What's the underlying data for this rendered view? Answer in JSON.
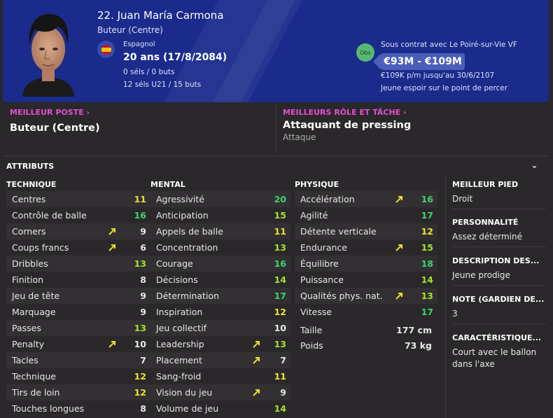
{
  "player": {
    "name": "22. Juan María Carmona",
    "position": "Buteur (Centre)",
    "nationality": "Espagnol",
    "age": "20 ans (17/8/2084)",
    "caps": "0 séls / 0 buts",
    "u21": "12 séls U21 / 15 buts",
    "obs_badge": "Obs",
    "contract": "Sous contrat avec Le Poiré-sur-Vie VF",
    "value": "€93M - €109M",
    "wage": "€109K p/m jusqu'au 30/6/2107",
    "prospect": "Jeune espoir sur le point de percer"
  },
  "best": {
    "position_label": "MEILLEUR POSTE",
    "position_value": "Buteur (Centre)",
    "role_label": "MEILLEURS RÔLE ET TÂCHE",
    "role_value": "Attaquant de pressing",
    "duty_value": "Attaque"
  },
  "attributes_title": "ATTRIBUTS",
  "technical": {
    "title": "TECHNIQUE",
    "items": [
      {
        "name": "Centres",
        "value": "11",
        "arrow": false
      },
      {
        "name": "Contrôle de balle",
        "value": "16",
        "arrow": false
      },
      {
        "name": "Corners",
        "value": "9",
        "arrow": true
      },
      {
        "name": "Coups francs",
        "value": "6",
        "arrow": true
      },
      {
        "name": "Dribbles",
        "value": "13",
        "arrow": false
      },
      {
        "name": "Finition",
        "value": "8",
        "arrow": false
      },
      {
        "name": "Jeu de tête",
        "value": "9",
        "arrow": false
      },
      {
        "name": "Marquage",
        "value": "9",
        "arrow": false
      },
      {
        "name": "Passes",
        "value": "13",
        "arrow": false
      },
      {
        "name": "Penalty",
        "value": "10",
        "arrow": true
      },
      {
        "name": "Tacles",
        "value": "7",
        "arrow": false
      },
      {
        "name": "Technique",
        "value": "12",
        "arrow": false
      },
      {
        "name": "Tirs de loin",
        "value": "12",
        "arrow": false
      },
      {
        "name": "Touches longues",
        "value": "8",
        "arrow": false
      }
    ]
  },
  "mental": {
    "title": "MENTAL",
    "items": [
      {
        "name": "Agressivité",
        "value": "20",
        "arrow": false
      },
      {
        "name": "Anticipation",
        "value": "15",
        "arrow": false
      },
      {
        "name": "Appels de balle",
        "value": "11",
        "arrow": false
      },
      {
        "name": "Concentration",
        "value": "13",
        "arrow": false
      },
      {
        "name": "Courage",
        "value": "16",
        "arrow": false
      },
      {
        "name": "Décisions",
        "value": "14",
        "arrow": false
      },
      {
        "name": "Détermination",
        "value": "17",
        "arrow": false
      },
      {
        "name": "Inspiration",
        "value": "12",
        "arrow": false
      },
      {
        "name": "Jeu collectif",
        "value": "10",
        "arrow": false
      },
      {
        "name": "Leadership",
        "value": "13",
        "arrow": true
      },
      {
        "name": "Placement",
        "value": "7",
        "arrow": true
      },
      {
        "name": "Sang-froid",
        "value": "11",
        "arrow": false
      },
      {
        "name": "Vision du jeu",
        "value": "9",
        "arrow": true
      },
      {
        "name": "Volume de jeu",
        "value": "14",
        "arrow": false
      }
    ]
  },
  "physical": {
    "title": "PHYSIQUE",
    "items": [
      {
        "name": "Accélération",
        "value": "16",
        "arrow": true
      },
      {
        "name": "Agilité",
        "value": "17",
        "arrow": false
      },
      {
        "name": "Détente verticale",
        "value": "12",
        "arrow": false
      },
      {
        "name": "Endurance",
        "value": "15",
        "arrow": true
      },
      {
        "name": "Équilibre",
        "value": "18",
        "arrow": false
      },
      {
        "name": "Puissance",
        "value": "14",
        "arrow": false
      },
      {
        "name": "Qualités phys. nat.",
        "value": "13",
        "arrow": true
      },
      {
        "name": "Vitesse",
        "value": "17",
        "arrow": false
      }
    ],
    "height_label": "Taille",
    "height_value": "177 cm",
    "weight_label": "Poids",
    "weight_value": "73 kg"
  },
  "side": {
    "foot_label": "MEILLEUR PIED",
    "foot_value": "Droit",
    "personality_label": "PERSONNALITÉ",
    "personality_value": "Assez déterminé",
    "description_label": "DESCRIPTION DES...",
    "description_value": "Jeune prodige",
    "gk_label": "NOTE (GARDIEN DE...",
    "gk_value": "3",
    "trait_label": "CARACTÉRISTIQUE...",
    "trait_value": "Court avec le ballon dans l'axe"
  },
  "colors": {
    "header_bg": "#1a2b8c",
    "accent_pink": "#e24fd2",
    "value_white": "#e8e8e8",
    "value_yellow": "#f0e131",
    "value_lime": "#a6e22e",
    "value_green": "#3ed46a",
    "arrow_yellow": "#e8e02a"
  }
}
